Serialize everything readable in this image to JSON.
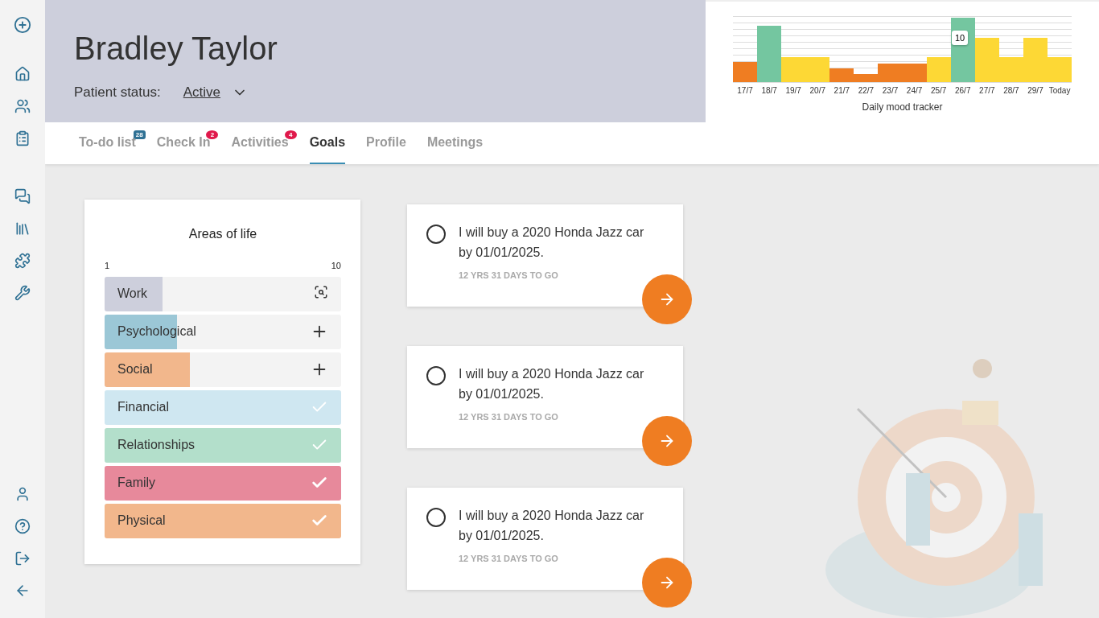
{
  "patient": {
    "name": "Bradley Taylor",
    "status_label": "Patient status:",
    "status": "Active"
  },
  "mood_tracker": {
    "title": "Daily mood tracker",
    "tooltip": "10",
    "days": [
      "17/7",
      "18/7",
      "19/7",
      "20/7",
      "21/7",
      "22/7",
      "23/7",
      "24/7",
      "25/7",
      "26/7",
      "27/7",
      "28/7",
      "29/7",
      "Today"
    ]
  },
  "tabs": [
    {
      "label": "To-do list",
      "badge": {
        "text": "28",
        "kind": "count"
      },
      "selected": false
    },
    {
      "label": "Check In",
      "badge": {
        "text": "2",
        "kind": "alert"
      },
      "selected": false
    },
    {
      "label": "Activities",
      "badge": {
        "text": "4",
        "kind": "alert"
      },
      "selected": false
    },
    {
      "label": "Goals",
      "selected": true
    },
    {
      "label": "Profile",
      "selected": false
    },
    {
      "label": "Meetings",
      "selected": false
    }
  ],
  "areas_of_life": {
    "title": "Areas of life",
    "scale_min": "1",
    "scale_max": "10",
    "items": [
      {
        "label": "Work",
        "level": 0.245,
        "color": "#cdcfdc",
        "kind": "search"
      },
      {
        "label": "Psychological",
        "level": 0.306,
        "color": "#9bc7d6",
        "kind": "add"
      },
      {
        "label": "Social",
        "level": 0.361,
        "color": "#f2b78c",
        "kind": "add"
      },
      {
        "label": "Financial",
        "level": 1,
        "color": "#cfe7f1",
        "kind": "done"
      },
      {
        "label": "Relationships",
        "level": 1,
        "color": "#b3dfcb",
        "kind": "done"
      },
      {
        "label": "Family",
        "level": 1,
        "color": "#e7899b",
        "kind": "done"
      },
      {
        "label": "Physical",
        "level": 1,
        "color": "#f2b78c",
        "kind": "done"
      }
    ]
  },
  "goals": [
    {
      "text": "I will buy a 2020 Honda Jazz car by 01/01/2025.",
      "countdown": "12 YRS 31 DAYS TO GO",
      "checked": false
    },
    {
      "text": "I will buy a 2020 Honda Jazz car by 01/01/2025.",
      "countdown": "12 YRS 31 DAYS TO GO",
      "checked": false
    },
    {
      "text": "I will buy a 2020 Honda Jazz car by 01/01/2025.",
      "countdown": "12 YRS 31 DAYS TO GO",
      "checked": false
    }
  ]
}
